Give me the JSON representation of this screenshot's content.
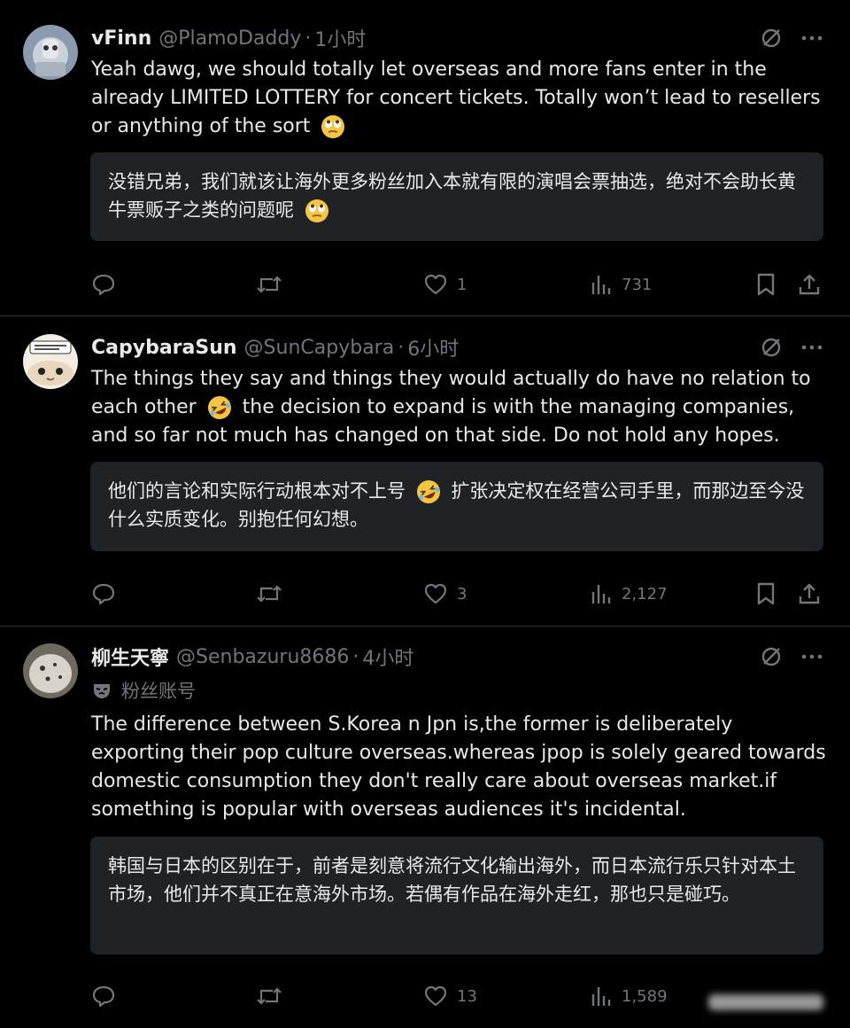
{
  "tweets": [
    {
      "display_name": "vFinn",
      "handle": "@PlamoDaddy",
      "dot": "·",
      "time": "1小时",
      "text_parts": [
        "Yeah dawg, we should totally let overseas and more fans enter in the already LIMITED LOTTERY for concert tickets. Totally won’t lead to resellers or anything of the sort",
        ""
      ],
      "emoji": "eye-roll-emoji",
      "translation_parts": [
        "没错兄弟，我们就该让海外更多粉丝加入本就有限的演唱会票抽选，绝对不会助长黄牛票贩子之类的问题呢",
        ""
      ],
      "stats": {
        "replies": "",
        "retweets": "",
        "likes": "1",
        "views": "731"
      }
    },
    {
      "display_name": "CapybaraSun",
      "handle": "@SunCapybara",
      "dot": "·",
      "time": "6小时",
      "text_parts": [
        "The things they say and things they would actually do have no relation to each other",
        "the decision to expand is with the managing companies, and so far not much has changed on that side. Do not hold any hopes."
      ],
      "emoji": "rolling-laughing-emoji",
      "translation_parts": [
        "他们的言论和实际行动根本对不上号",
        "扩张决定权在经营公司手里，而那边至今没什么实质变化。别抱任何幻想。"
      ],
      "stats": {
        "replies": "",
        "retweets": "",
        "likes": "3",
        "views": "2,127"
      }
    },
    {
      "display_name": "柳生天寧",
      "handle": "@Senbazuru8686",
      "dot": "·",
      "time": "4小时",
      "badge": "粉丝账号",
      "text_parts": [
        "The difference between S.Korea n Jpn is,the former is deliberately exporting their pop culture overseas.whereas jpop is solely geared towards domestic consumption they don't really care about overseas market.if something is popular with overseas audiences it's incidental."
      ],
      "translation_parts": [
        "韩国与日本的区别在于，前者是刻意将流行文化输出海外，而日本流行乐只针对本土市场，他们并不真正在意海外市场。若偶有作品在海外走红，那也只是碰巧。"
      ],
      "stats": {
        "replies": "",
        "retweets": "",
        "likes": "13",
        "views": "1,589"
      }
    }
  ],
  "colors": {
    "background": "#000000",
    "text": "#e7e9ea",
    "muted": "#71767b",
    "translation_bg": "#202326",
    "divider": "#2f3336"
  },
  "icons": [
    "reply-icon",
    "retweet-icon",
    "like-icon",
    "views-icon",
    "bookmark-icon",
    "share-icon",
    "grok-icon",
    "more-icon",
    "mask-icon"
  ]
}
